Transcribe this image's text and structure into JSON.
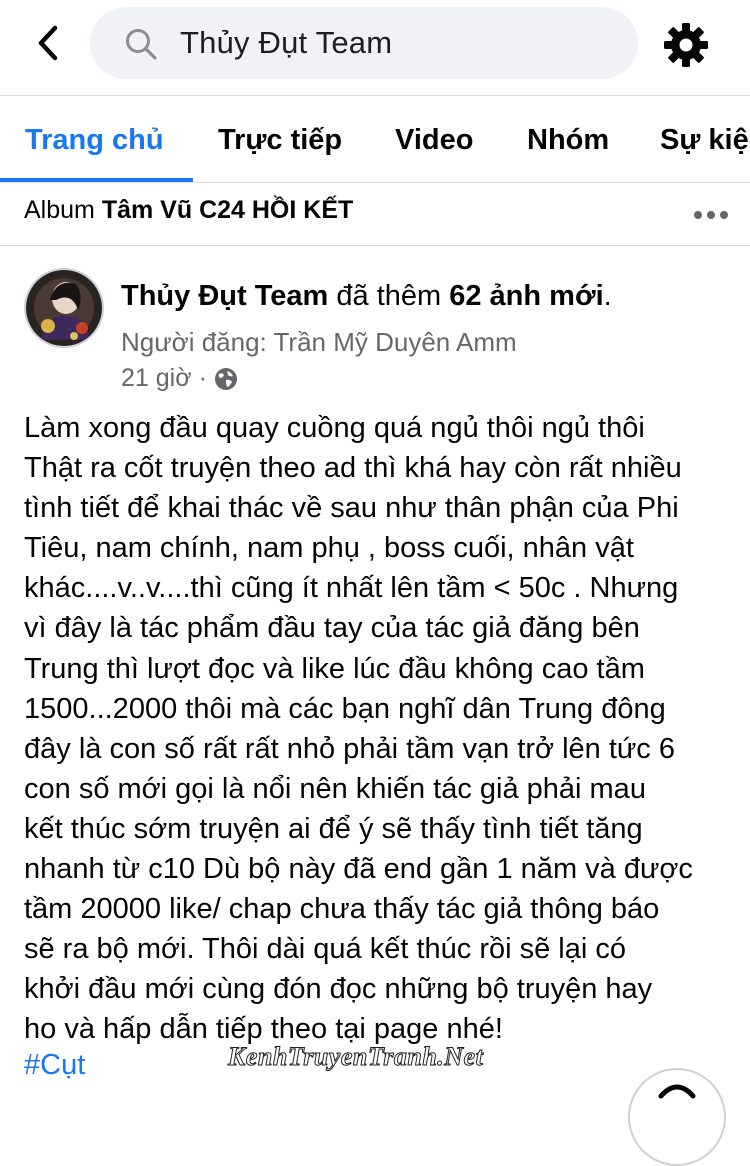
{
  "header": {
    "search_value": "Thủy Đụt Team"
  },
  "tabs": [
    {
      "label": "Trang chủ",
      "active": true
    },
    {
      "label": "Trực tiếp"
    },
    {
      "label": "Video"
    },
    {
      "label": "Nhóm"
    },
    {
      "label": "Sự kiện"
    }
  ],
  "album": {
    "prefix": "Album",
    "name": "Tâm Vũ C24 HỒI KẾT"
  },
  "post": {
    "page_name": "Thủy Đụt Team",
    "action_text": "đã thêm",
    "photo_count": "62 ảnh mới",
    "poster": "Người đăng: Trần Mỹ Duyên Amm",
    "time": "21 giờ",
    "lines": [
      "Làm xong đầu quay cuồng quá ngủ thôi ngủ thôi",
      "Thật ra cốt truyện theo ad thì khá hay còn rất nhiều",
      "tình tiết để khai thác về sau như thân phận của Phi",
      "Tiêu,  nam chính, nam phụ , boss cuối, nhân vật",
      "khác....v..v....thì cũng ít nhất lên tầm < 50c . Nhưng",
      "vì đây là tác phẩm đầu tay của tác giả đăng bên",
      "Trung thì lượt đọc và like lúc đầu không cao tầm",
      "1500...2000 thôi mà các bạn nghĩ dân Trung đông",
      "đây là con số rất rất nhỏ phải tầm vạn trở lên tức 6",
      "con số mới gọi là nổi nên khiến tác giả phải mau",
      "kết thúc sớm truyện ai để ý sẽ thấy tình tiết tăng",
      "nhanh từ c10 Dù bộ này đã end gần 1 năm và được",
      "tầm 20000 like/ chap chưa thấy tác giả thông báo",
      "sẽ ra bộ mới.  Thôi dài quá kết thúc rồi sẽ lại có",
      "khởi đầu mới cùng đón đọc những bộ truyện hay",
      "ho và hấp dẫn tiếp theo tại page nhé!"
    ],
    "hashtag": "#Cụt"
  },
  "watermark": "KenhTruyenTranh.Net",
  "icons": {
    "back": "chevron-left-icon",
    "search": "search-icon",
    "settings": "gear-icon",
    "more": "more-horizontal-icon",
    "privacy": "globe-icon"
  },
  "colors": {
    "accent": "#1877f2",
    "secondary_text": "#65676b",
    "search_bg": "#f0f2f5"
  }
}
